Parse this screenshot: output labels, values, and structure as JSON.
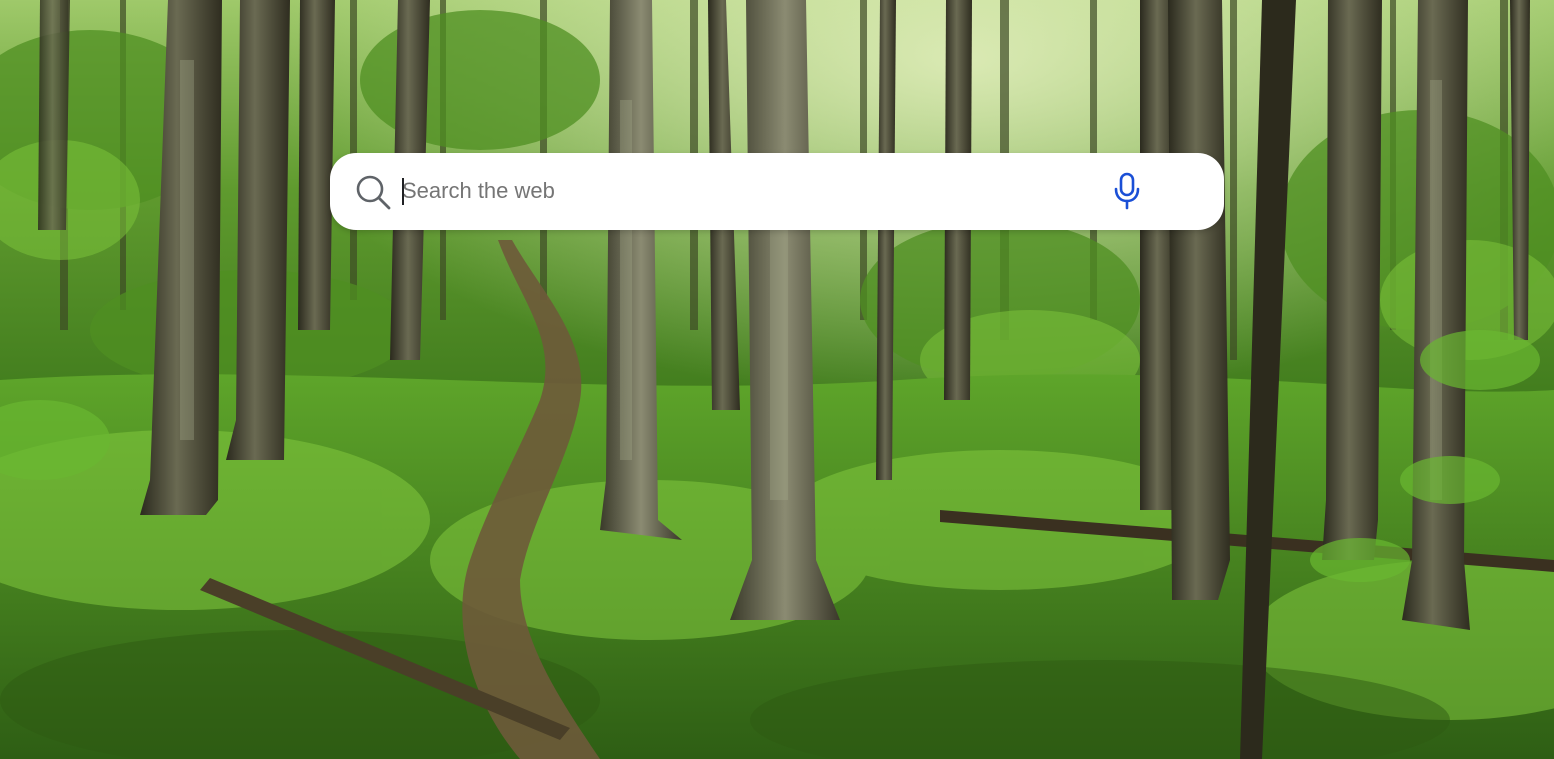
{
  "search": {
    "placeholder": "Search the web",
    "value": ""
  },
  "icons": {
    "search": "search-icon",
    "mic": "microphone-icon"
  },
  "colors": {
    "mic_accent": "#1a4fd6",
    "search_icon": "#5f6368",
    "placeholder": "#757575",
    "box_background": "#ffffff"
  },
  "background": {
    "scene": "forest"
  }
}
